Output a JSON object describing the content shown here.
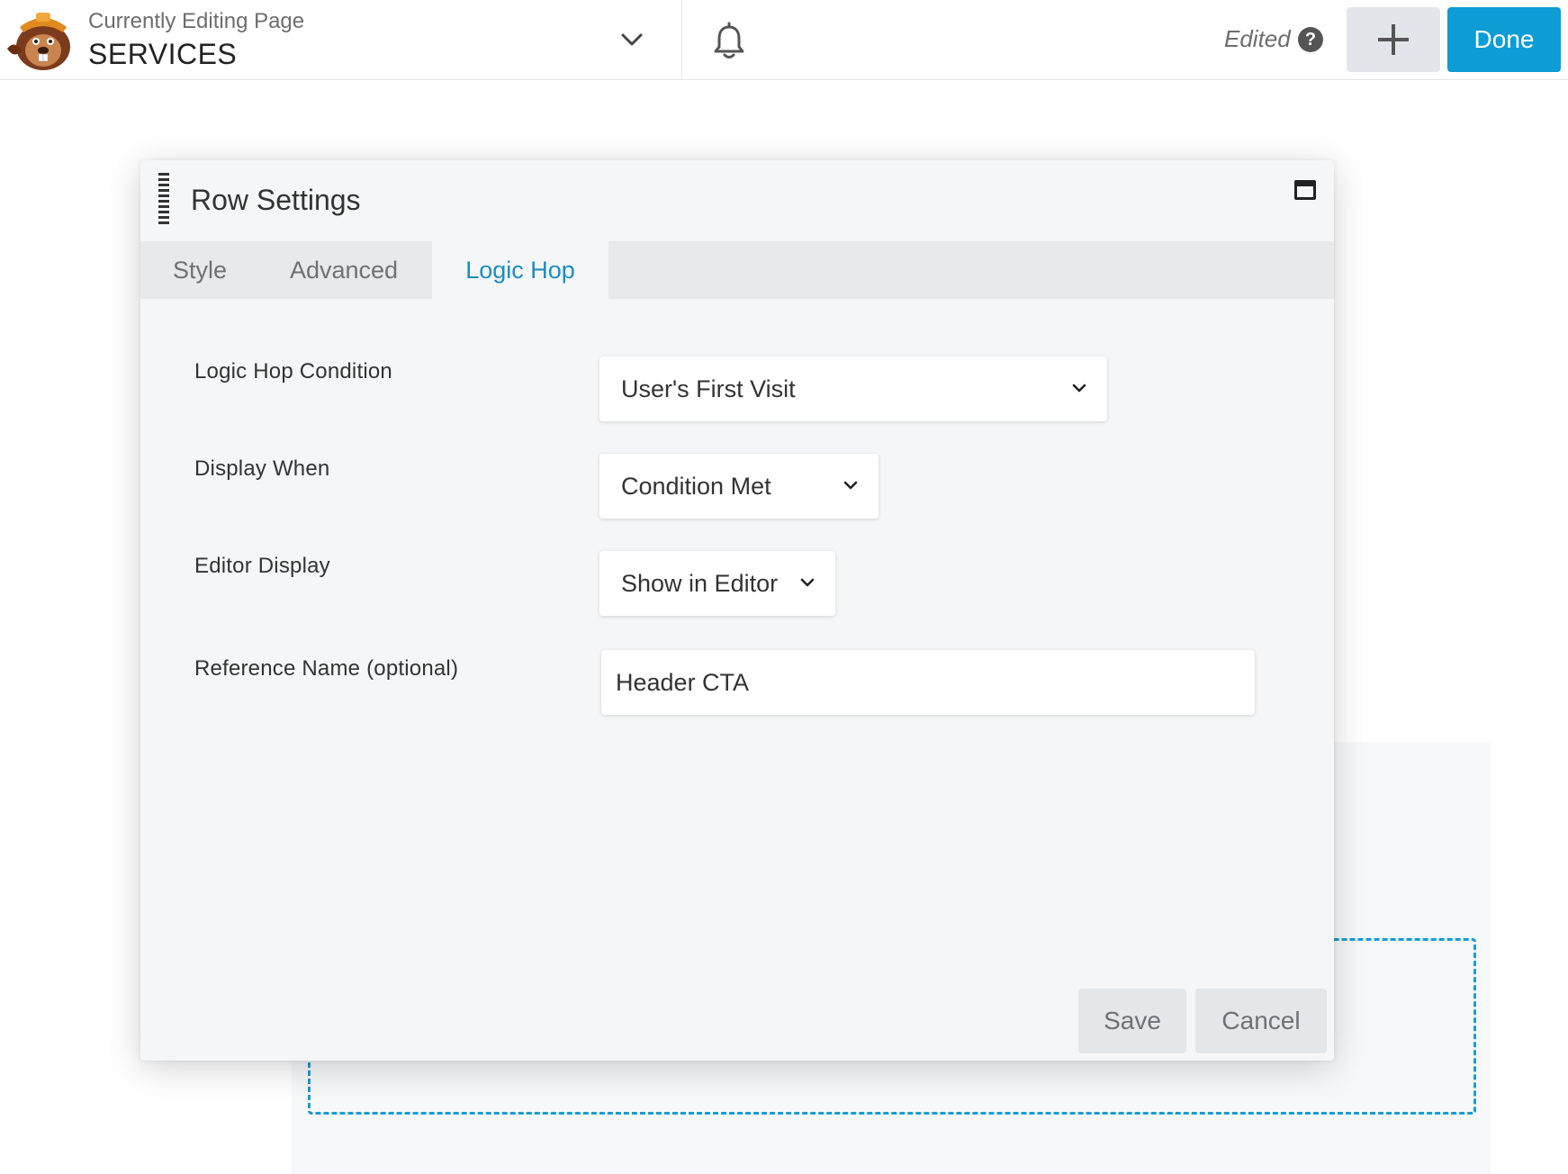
{
  "header": {
    "kicker": "Currently Editing Page",
    "page_title": "SERVICES",
    "status": "Edited",
    "help_glyph": "?",
    "done_label": "Done",
    "accent_color": "#0e9cd5"
  },
  "modal": {
    "title": "Row Settings",
    "tabs": [
      {
        "label": "Style",
        "active": false
      },
      {
        "label": "Advanced",
        "active": false
      },
      {
        "label": "Logic Hop",
        "active": true
      }
    ],
    "fields": {
      "condition": {
        "label": "Logic Hop Condition",
        "value": "User's First Visit"
      },
      "display_when": {
        "label": "Display When",
        "value": "Condition Met"
      },
      "editor_display": {
        "label": "Editor Display",
        "value": "Show in Editor"
      },
      "reference_name": {
        "label": "Reference Name (optional)",
        "value": "Header CTA"
      }
    },
    "save_label": "Save",
    "cancel_label": "Cancel"
  },
  "icons": [
    "beaver-logo-icon",
    "chevron-down-icon",
    "bell-icon",
    "help-icon",
    "plus-icon",
    "drag-handle-icon",
    "maximize-icon"
  ]
}
